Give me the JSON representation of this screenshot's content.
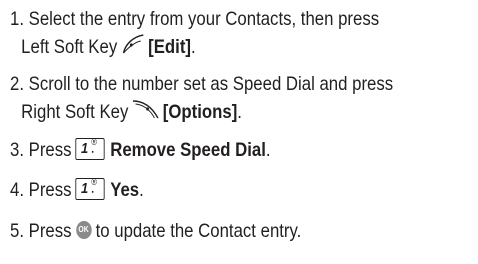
{
  "steps": [
    {
      "line1": "1. Select the entry from your Contacts, then press",
      "line2_text": "Left Soft Key",
      "line2_icon": "left-soft-key-icon",
      "line2_bold": "[Edit]",
      "line2_end": "."
    },
    {
      "line1": "2. Scroll to the number set as Speed Dial and press",
      "line2_text": "Right Soft Key",
      "line2_icon": "right-soft-key-icon",
      "line2_bold": "[Options]",
      "line2_end": "."
    },
    {
      "prefix": "3. Press",
      "key_icon": "key-1-icon",
      "bold": "Remove Speed Dial",
      "end": "."
    },
    {
      "prefix": "4. Press",
      "key_icon": "key-1-icon",
      "bold": "Yes",
      "end": "."
    },
    {
      "prefix": "5. Press",
      "ok_icon": "ok-key-icon",
      "ok_label": "OK",
      "suffix": "to update the Contact entry."
    }
  ],
  "key_one": {
    "number": "1",
    "symbol": "®",
    "punct": "⠂"
  }
}
